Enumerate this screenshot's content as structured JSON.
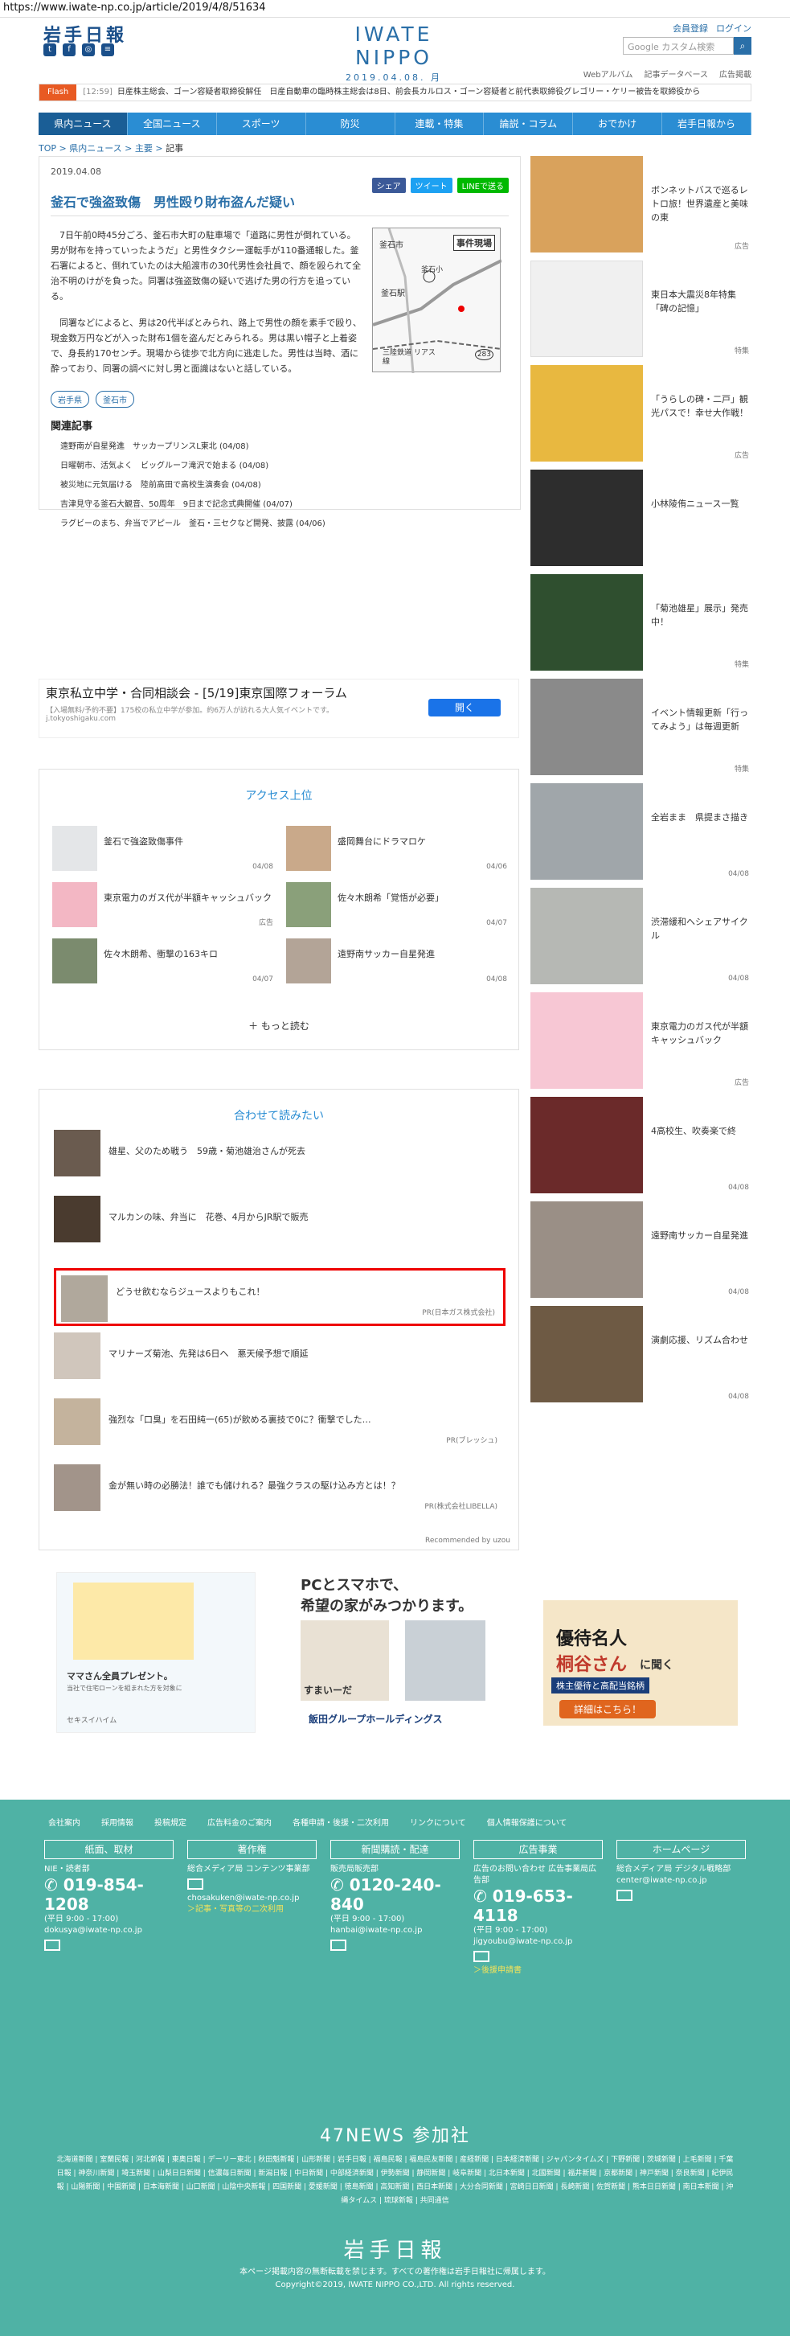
{
  "url": "https://www.iwate-np.co.jp/article/2019/4/8/51634",
  "header": {
    "logo": "岩手日報",
    "brand": "IWATE NIPPO",
    "date": "2019.04.08. 月",
    "links": [
      "会員登録",
      "ログイン"
    ],
    "search_placeholder": "Google カスタム検索",
    "subnav": [
      "Webアルバム",
      "記事データベース",
      "広告掲載"
    ]
  },
  "flash": {
    "label": "Flash",
    "time": "[12:59]",
    "text": "日産株主総会、ゴーン容疑者取締役解任　日産自動車の臨時株主総会は8日、前会長カルロス・ゴーン容疑者と前代表取締役グレゴリー・ケリー被告を取締役から"
  },
  "gnav": [
    "県内ニュース",
    "全国ニュース",
    "スポーツ",
    "防災",
    "連載・特集",
    "論説・コラム",
    "おでかけ",
    "岩手日報から"
  ],
  "breadcrumb": [
    "TOP",
    "県内ニュース",
    "主要",
    "記事"
  ],
  "article": {
    "date": "2019.04.08",
    "share": [
      "シェア",
      "ツイート",
      "LINEで送る"
    ],
    "title": "釜石で強盗致傷　男性殴り財布盗んだ疑い",
    "p1": "7日午前0時45分ごろ、釜石市大町の駐車場で「道路に男性が倒れている。男が財布を持っていったようだ」と男性タクシー運転手が110番通報した。釜石署によると、倒れていたのは大船渡市の30代男性会社員で、顔を殴られて全治不明のけがを負った。同署は強盗致傷の疑いで逃げた男の行方を追っている。",
    "p2": "同署などによると、男は20代半ばとみられ、路上で男性の顔を素手で殴り、現金数万円などが入った財布1個を盗んだとみられる。男は黒い帽子と上着姿で、身長約170センチ。現場から徒歩で北方向に逃走した。男性は当時、酒に酔っており、同署の調べに対し男と面識はないと話している。",
    "map": {
      "label": "事件現場",
      "city": "釜石市",
      "station1": "釜石駅",
      "station2": "釜石小",
      "rail": "三陸鉄道 リアス線",
      "route": "283"
    },
    "tags": [
      "岩手県",
      "釜石市"
    ],
    "related_title": "関連記事",
    "related": [
      "遠野南が自星発進　サッカープリンスL東北 (04/08)",
      "日曜朝市、活気よく　ビッグルーフ滝沢で始まる (04/08)",
      "被災地に元気届ける　陸前高田で高校生演奏会 (04/08)",
      "吉津見守る釜石大観音、50周年　9日まで記念式典開催 (04/07)",
      "ラグビーのまち、弁当でアピール　釜石・三セクなど開発、披露 (04/06)"
    ]
  },
  "ad": {
    "headline": "東京私立中学・合同相談会 - [5/19]東京国際フォーラム",
    "sub": "【入場無料/予約不要】175校の私立中学が参加。約6万人が訪れる大人気イベントです。",
    "domain": "j.tokyoshigaku.com",
    "button": "開く"
  },
  "ranking": {
    "title": "アクセス上位",
    "items": [
      {
        "title": "釜石で強盗致傷事件",
        "date": "04/08"
      },
      {
        "title": "盛岡舞台にドラマロケ",
        "date": "04/06"
      },
      {
        "title": "東京電力のガス代が半額キャッシュバック",
        "date": "広告"
      },
      {
        "title": "佐々木朗希「覚悟が必要」",
        "date": "04/07"
      },
      {
        "title": "佐々木朗希、衝撃の163キロ",
        "date": "04/07"
      },
      {
        "title": "遠野南サッカー自星発進",
        "date": "04/08"
      }
    ],
    "more": "もっと読む"
  },
  "read": {
    "title": "合わせて読みたい",
    "items": [
      {
        "title": "雄星、父のため戦う　59歳・菊池雄治さんが死去",
        "pr": ""
      },
      {
        "title": "マルカンの味、弁当に　花巻、4月からJR駅で販売",
        "pr": ""
      },
      {
        "title": "どうせ飲むならジュースよりもこれ！",
        "pr": "PR(日本ガス株式会社)"
      },
      {
        "title": "マリナーズ菊池、先発は6日へ　悪天候予想で順延",
        "pr": ""
      },
      {
        "title": "強烈な「口臭」を石田純一(65)が飲める裏技で0に？衝撃でした…",
        "pr": "PR(ブレッシュ)"
      },
      {
        "title": "金が無い時の必勝法！誰でも儲けれる？最強クラスの駆け込み方とは！？",
        "pr": "PR(株式会社LIBELLA)"
      }
    ],
    "recommended": "Recommended by uzou"
  },
  "bottom_ads": {
    "ad1_title": "ママさん全員プレゼント。",
    "ad1_sub": "当社で住宅ローンを組まれた方を対象に",
    "ad1_brand": "セキスイハイム",
    "ad2_title1": "PCとスマホで、",
    "ad2_title2": "希望の家がみつかります。",
    "ad2_name": "すまいーだ",
    "ad2_group": "飯田グループホールディングス"
  },
  "sidebar": [
    {
      "title": "ボンネットバスで巡るレトロ旅！世界遺産と美味の東",
      "cat": "広告",
      "color": "#d9a25c"
    },
    {
      "title": "東日本大震災8年特集「碑の記憶」",
      "cat": "特集",
      "color": "#f4f4f4"
    },
    {
      "title": "「うらしの碑・二戸」観光パスで！幸せ大作戦！",
      "cat": "広告",
      "color": "#e8b840"
    },
    {
      "title": "小林陵侑ニュース一覧",
      "cat": "",
      "color": "#2d2d2d"
    },
    {
      "title": "「菊池雄星」展示」発売中！",
      "cat": "特集",
      "color": "#2f4f2f"
    },
    {
      "title": "イベント情報更新「行ってみよう」は毎週更新",
      "cat": "特集",
      "color": "#8a8a8a"
    },
    {
      "title": "全岩まま　県提まさ描き",
      "cat": "04/08",
      "color": "#a0a6aa"
    },
    {
      "title": "渋滞緩和へシェアサイクル",
      "cat": "04/08",
      "color": "#b6b8b4"
    },
    {
      "title": "東京電力のガス代が半額キャッシュバック",
      "cat": "広告",
      "color": "#f7c7d4"
    },
    {
      "title": "4高校生、吹奏楽で終",
      "cat": "04/08",
      "color": "#6b2a2a"
    },
    {
      "title": "遠野南サッカー自星発進",
      "cat": "04/08",
      "color": "#9a8f86"
    },
    {
      "title": "演劇応援、リズム合わせ",
      "cat": "04/08",
      "color": "#6e5a44"
    }
  ],
  "side_ad": {
    "title1": "優待名人",
    "title2": "桐谷さん",
    "title3": "に聞く",
    "sub": "株主優待と高配当銘柄",
    "cta": "詳細はこちら！"
  },
  "footer": {
    "links": [
      "会社案内",
      "採用情報",
      "投稿規定",
      "広告料金のご案内",
      "各種申請・後援・二次利用",
      "リンクについて",
      "個人情報保護について"
    ],
    "cols": [
      {
        "head": "紙面、取材",
        "line1": "NIE・読者部",
        "tel": "019-854-1208",
        "hours": "(平日 9:00 - 17:00)",
        "mail": "dokusya@iwate-np.co.jp",
        "extra": ""
      },
      {
        "head": "著作権",
        "line1": "総合メディア局 コンテンツ事業部",
        "tel": "",
        "hours": "",
        "mail": "chosakuken@iwate-np.co.jp",
        "extra": "＞記事・写真等の二次利用"
      },
      {
        "head": "新聞購読・配達",
        "line1": "販売局販売部",
        "tel": "0120-240-840",
        "hours": "(平日 9:00 - 17:00)",
        "mail": "hanbai@iwate-np.co.jp",
        "extra": ""
      },
      {
        "head": "広告事業",
        "line1": "広告のお問い合わせ 広告事業局広告部",
        "tel": "019-653-4118",
        "hours": "(平日 9:00 - 17:00)",
        "mail": "jigyoubu@iwate-np.co.jp",
        "extra": "＞後援申請書"
      },
      {
        "head": "ホームページ",
        "line1": "総合メディア局 デジタル戦略部",
        "tel": "",
        "hours": "",
        "mail": "center@iwate-np.co.jp",
        "extra": ""
      }
    ],
    "news47": "47NEWS 参加社",
    "papers": "北海道新聞 | 室蘭民報 | 河北新報 | 東奥日報 | デーリー東北 | 秋田魁新報 | 山形新聞 | 岩手日報 | 福島民報 | 福島民友新聞 | 産経新聞 | 日本経済新聞 | ジャパンタイムズ | 下野新聞 | 茨城新聞 | 上毛新聞 | 千葉日報 | 神奈川新聞 | 埼玉新聞 | 山梨日日新聞 | 信濃毎日新聞 | 新潟日報 | 中日新聞 | 中部経済新聞 | 伊勢新聞 | 静岡新聞 | 岐阜新聞 | 北日本新聞 | 北國新聞 | 福井新聞 | 京都新聞 | 神戸新聞 | 奈良新聞 | 紀伊民報 | 山陽新聞 | 中国新聞 | 日本海新聞 | 山口新聞 | 山陰中央新報 | 四国新聞 | 愛媛新聞 | 徳島新聞 | 高知新聞 | 西日本新聞 | 大分合同新聞 | 宮崎日日新聞 | 長崎新聞 | 佐賀新聞 | 熊本日日新聞 | 南日本新聞 | 沖縄タイムス | 琉球新報 | 共同通信",
    "logo": "岩手日報",
    "notice": "本ページ掲載内容の無断転載を禁じます。すべての著作権は岩手日報社に帰属します。",
    "copyright": "Copyright©2019, IWATE NIPPO CO.,LTD. All rights reserved."
  }
}
